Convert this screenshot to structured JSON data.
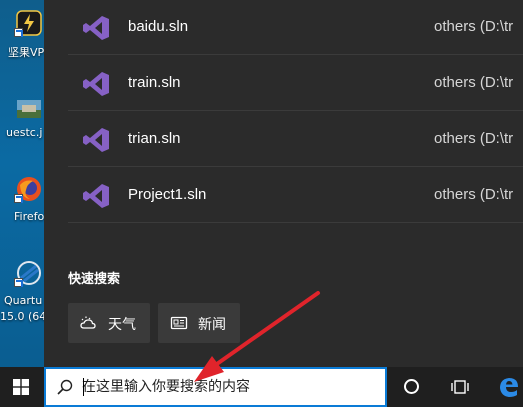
{
  "desktop": {
    "icons": [
      {
        "label": "坚果VP"
      },
      {
        "label": "uestc.j"
      },
      {
        "label": "Firefo"
      },
      {
        "label": "Quartu"
      },
      {
        "label": "15.0 (64"
      }
    ]
  },
  "recent": [
    {
      "name": "baidu.sln",
      "path": "others (D:\\tr"
    },
    {
      "name": "train.sln",
      "path": "others (D:\\tr"
    },
    {
      "name": "trian.sln",
      "path": "others (D:\\tr"
    },
    {
      "name": "Project1.sln",
      "path": "others (D:\\tr"
    }
  ],
  "quick_search": {
    "title": "快速搜索",
    "items": [
      {
        "label": "天气",
        "icon": "weather-icon"
      },
      {
        "label": "新闻",
        "icon": "news-icon"
      }
    ]
  },
  "taskbar": {
    "search_placeholder": "在这里输入你要搜索的内容"
  },
  "colors": {
    "panel_bg": "#2b2b2b",
    "taskbar_bg": "#1f1f1f",
    "vs_purple": "#8661c5",
    "search_border": "#0a7bd6",
    "annotation_red": "#e0242b"
  }
}
